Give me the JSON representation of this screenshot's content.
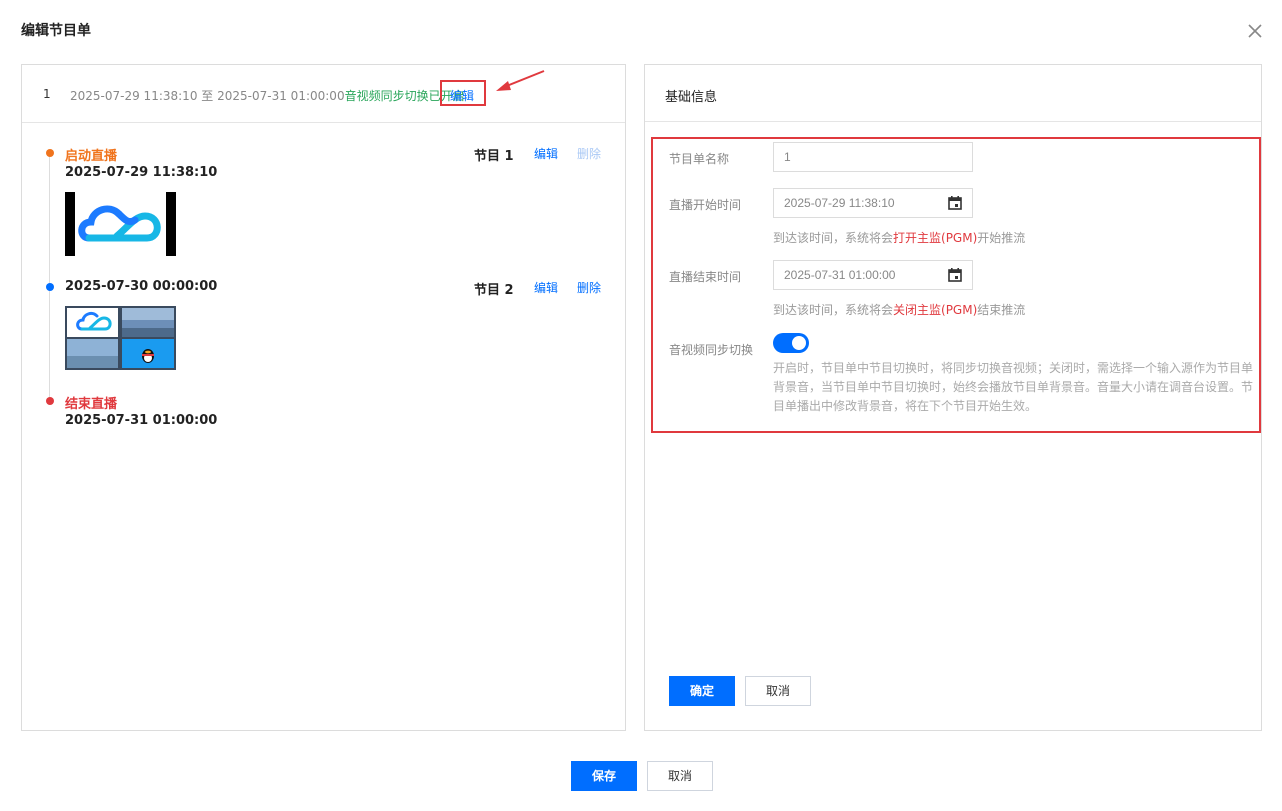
{
  "dialog": {
    "title": "编辑节目单"
  },
  "playlist": {
    "index": "1",
    "start": "2025-07-29 11:38:10",
    "separator": "至",
    "end": "2025-07-31 01:00:00",
    "sync_status": "音视频同步切换已开启",
    "edit_label": "编辑"
  },
  "timeline": {
    "start_event": {
      "label": "启动直播",
      "time": "2025-07-29 11:38:10",
      "program": "节目 1",
      "edit": "编辑",
      "delete": "删除"
    },
    "second_event": {
      "time": "2025-07-30 00:00:00",
      "program": "节目 2",
      "edit": "编辑",
      "delete": "删除"
    },
    "end_event": {
      "label": "结束直播",
      "time": "2025-07-31 01:00:00"
    }
  },
  "basic_info": {
    "section_title": "基础信息",
    "name_label": "节目单名称",
    "name_value": "1",
    "start_label": "直播开始时间",
    "start_value": "2025-07-29 11:38:10",
    "start_hint_pre": "到达该时间，系统将会",
    "start_hint_red": "打开主监(PGM)",
    "start_hint_post": "开始推流",
    "end_label": "直播结束时间",
    "end_value": "2025-07-31 01:00:00",
    "end_hint_pre": "到达该时间，系统将会",
    "end_hint_red": "关闭主监(PGM)",
    "end_hint_post": "结束推流",
    "sync_label": "音视频同步切换",
    "sync_description": "开启时，节目单中节目切换时，将同步切换音视频；关闭时，需选择一个输入源作为节目单背景音，当节目单中节目切换时，始终会播放节目单背景音。音量大小请在调音台设置。节目单播出中修改背景音，将在下个节目开始生效。",
    "confirm_label": "确定",
    "cancel_label": "取消"
  },
  "footer": {
    "save_label": "保存",
    "cancel_label": "取消"
  },
  "icons": {
    "close": "close-icon",
    "calendar": "calendar-icon",
    "cloud_logo": "cloud-logo-icon",
    "qq": "qq-penguin-icon"
  },
  "colors": {
    "accent": "#006eff",
    "start_event": "#f0741d",
    "mid_event": "#006eff",
    "end_event": "#e0393e",
    "sync_green": "#29a55a",
    "highlight_red": "#e0393e"
  }
}
